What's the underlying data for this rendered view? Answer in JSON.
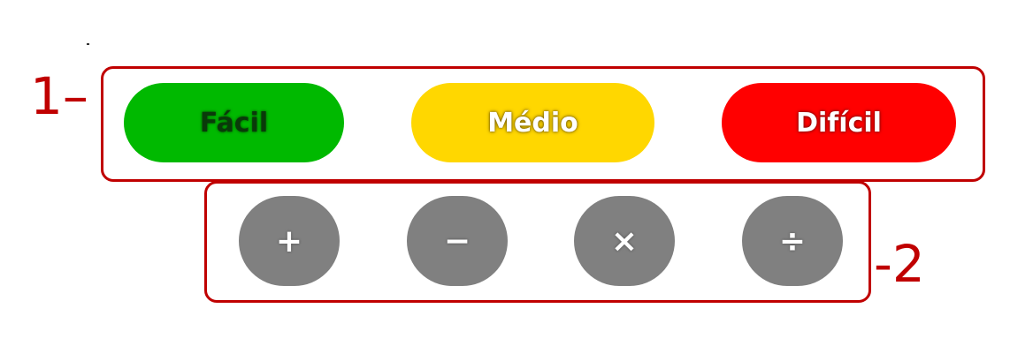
{
  "annotations": {
    "label_1": "1–",
    "label_2": "-2"
  },
  "difficulty": {
    "easy_label": "Fácil",
    "medium_label": "Médio",
    "hard_label": "Difícil",
    "colors": {
      "easy": "#00b900",
      "medium": "#ffd700",
      "hard": "#ff0000",
      "highlight_border": "#c00000"
    }
  },
  "operations": {
    "items": [
      {
        "symbol": "+",
        "icon": "plus-icon"
      },
      {
        "symbol": "−",
        "icon": "minus-icon"
      },
      {
        "symbol": "×",
        "icon": "times-icon"
      },
      {
        "symbol": "÷",
        "icon": "divide-icon"
      }
    ],
    "color": "#808080"
  }
}
